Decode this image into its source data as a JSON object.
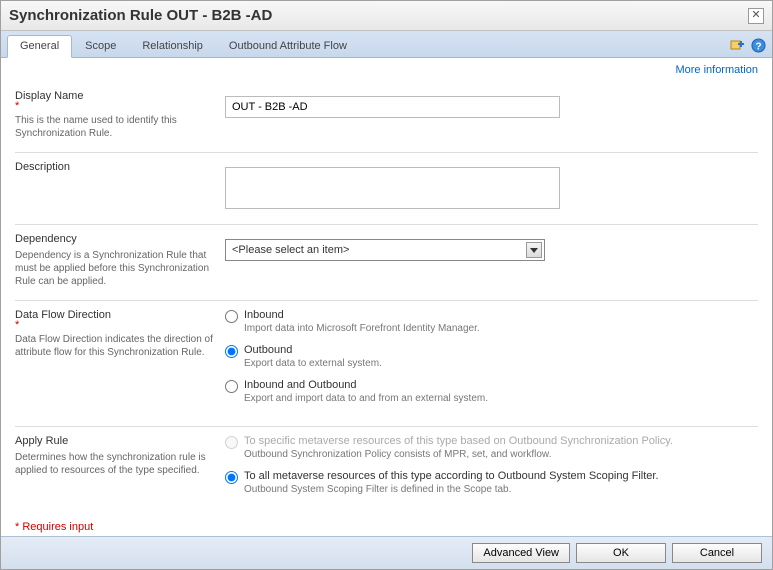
{
  "title": "Synchronization Rule OUT - B2B -AD",
  "tabs": {
    "general": "General",
    "scope": "Scope",
    "relationship": "Relationship",
    "outbound": "Outbound Attribute Flow"
  },
  "more_info": "More information",
  "display_name": {
    "label": "Display Name",
    "desc": "This is the name used to identify this Synchronization Rule.",
    "value": "OUT - B2B -AD"
  },
  "description": {
    "label": "Description",
    "value": ""
  },
  "dependency": {
    "label": "Dependency",
    "desc": "Dependency is a Synchronization Rule that must be applied before this Synchronization Rule can be applied.",
    "placeholder": "<Please select an item>"
  },
  "dataflow": {
    "label": "Data Flow Direction",
    "desc": "Data Flow Direction indicates the direction of attribute flow for this Synchronization Rule.",
    "opt1": {
      "label": "Inbound",
      "desc": "Import data into Microsoft Forefront Identity Manager."
    },
    "opt2": {
      "label": "Outbound",
      "desc": "Export data to external system."
    },
    "opt3": {
      "label": "Inbound and Outbound",
      "desc": "Export and import data to and from an external system."
    }
  },
  "apply_rule": {
    "label": "Apply Rule",
    "desc": "Determines how the synchronization rule is applied to resources of the type specified.",
    "opt1": {
      "label": "To specific metaverse resources of this type based on Outbound Synchronization Policy.",
      "desc": "Outbound Synchronization Policy consists of MPR, set, and workflow."
    },
    "opt2": {
      "label": "To all metaverse resources of this type according to Outbound System Scoping Filter.",
      "desc": "Outbound System Scoping Filter is defined in the Scope tab."
    }
  },
  "requires_input": "* Requires input",
  "buttons": {
    "advanced": "Advanced View",
    "ok": "OK",
    "cancel": "Cancel"
  }
}
